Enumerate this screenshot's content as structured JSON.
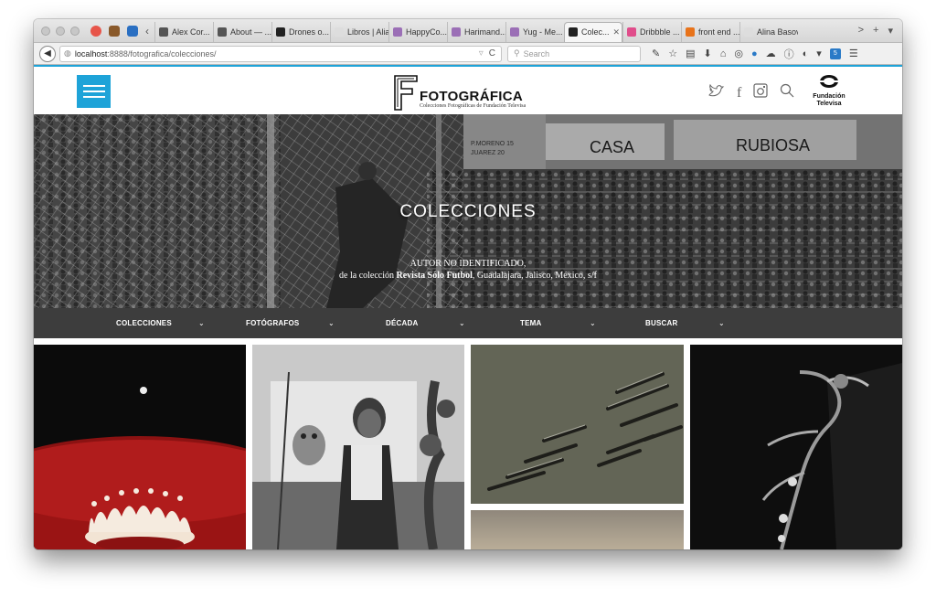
{
  "browser": {
    "tabs": [
      {
        "label": "Alex Cor...",
        "color": "#555555"
      },
      {
        "label": "About — ...",
        "color": "#555555"
      },
      {
        "label": "Drones o...",
        "color": "#222222"
      },
      {
        "label": "Libros | Alias",
        "color": "#dddddd"
      },
      {
        "label": "HappyCo...",
        "color": "#9b6fb6"
      },
      {
        "label": "Harimand...",
        "color": "#9b6fb6"
      },
      {
        "label": "Yug - Me...",
        "color": "#9b6fb6"
      },
      {
        "label": "Colec...",
        "color": "#222222",
        "active": true
      },
      {
        "label": "Dribbble ...",
        "color": "#e04d8b"
      },
      {
        "label": "front end ...",
        "color": "#e8731a"
      },
      {
        "label": "Alina Basova ...",
        "color": "#dddddd"
      }
    ],
    "url_host": "localhost",
    "url_path": ":8888/fotografica/colecciones/",
    "search_placeholder": "Search",
    "close_glyph": "✕",
    "new_tab_glyph": "+",
    "more_tabs_glyph": ">",
    "reload_glyph": "C",
    "back_glyph": "◀",
    "badge_count": "5"
  },
  "site": {
    "brand_title": "FOTOGRÁFICA",
    "brand_subtitle": "Colecciones Fotográficas de Fundación Televisa",
    "fundacion_line1": "Fundación",
    "fundacion_line2": "Televisa",
    "social_glyphs": {
      "twitter": "🐦",
      "facebook": "f",
      "instagram": "◎",
      "search": "⚲"
    },
    "accent_color": "#1ea3d8"
  },
  "hero": {
    "title": "COLECCIONES",
    "caption_line1": "AUTOR NO IDENTIFICADO,",
    "caption_prefix": "de la colección ",
    "caption_link": "Revista Sólo Futbol",
    "caption_suffix": ", Guadalajara, Jalisco, México, s/f"
  },
  "filters": [
    {
      "label": "COLECCIONES",
      "chevron": "⌄"
    },
    {
      "label": "FOTÓGRAFOS",
      "chevron": "⌄"
    },
    {
      "label": "DÉCADA",
      "chevron": "⌄"
    },
    {
      "label": "TEMA",
      "chevron": "⌄"
    },
    {
      "label": "BUSCAR",
      "chevron": "⌄"
    }
  ],
  "gallery": {
    "tiles": [
      "milk-crown-photo",
      "woman-with-owl-photo",
      "aerial-boats-photo",
      "landscape-photo",
      "skeleton-photo"
    ]
  }
}
